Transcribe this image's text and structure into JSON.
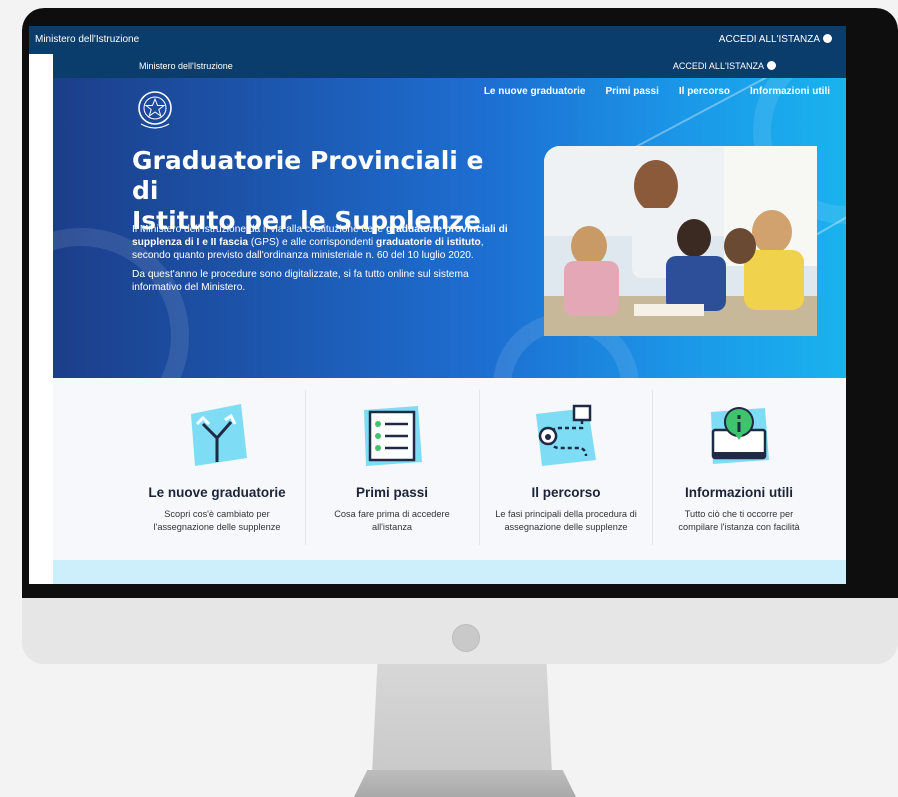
{
  "colors": {
    "nav_bg": "#0b3d6c",
    "accent": "#1d6fd2",
    "card_icon_bg": "#7fdcf5"
  },
  "top_bar": {
    "left_label": "Ministero dell'Istruzione",
    "right_label": "ACCEDI ALL'ISTANZA"
  },
  "nav_bar": {
    "left_label": "Ministero dell'Istruzione",
    "right_label": "ACCEDI ALL'ISTANZA"
  },
  "hero": {
    "nav": [
      "Le nuove graduatorie",
      "Primi passi",
      "Il percorso",
      "Informazioni utili"
    ],
    "title_line1": "Graduatorie Provinciali e di",
    "title_line2": "Istituto per le Supplenze",
    "p1_a": "Il Ministero dell'Istruzione dà il via alla costituzione delle ",
    "p1_b": "graduatorie provinciali di supplenza di I e II fascia",
    "p1_c": " (GPS) e alle corrispondenti ",
    "p1_d": "graduatorie di istituto",
    "p1_e": ", secondo quanto previsto dall'ordinanza ministeriale n. 60 del 10 luglio 2020.",
    "p2": "Da quest'anno le procedure sono digitalizzate, si fa tutto online sul sistema informativo del Ministero."
  },
  "cards": [
    {
      "title": "Le nuove graduatorie",
      "desc": "Scopri cos'è cambiato per l'assegnazione delle supplenze",
      "icon": "directions-icon"
    },
    {
      "title": "Primi passi",
      "desc": "Cosa fare prima di accedere all'istanza",
      "icon": "checklist-icon"
    },
    {
      "title": "Il percorso",
      "desc": "Le fasi principali della procedura di assegnazione delle supplenze",
      "icon": "route-icon"
    },
    {
      "title": "Informazioni utili",
      "desc": "Tutto ciò che ti occorre per compilare l'istanza con facilità",
      "icon": "info-monitor-icon"
    }
  ]
}
